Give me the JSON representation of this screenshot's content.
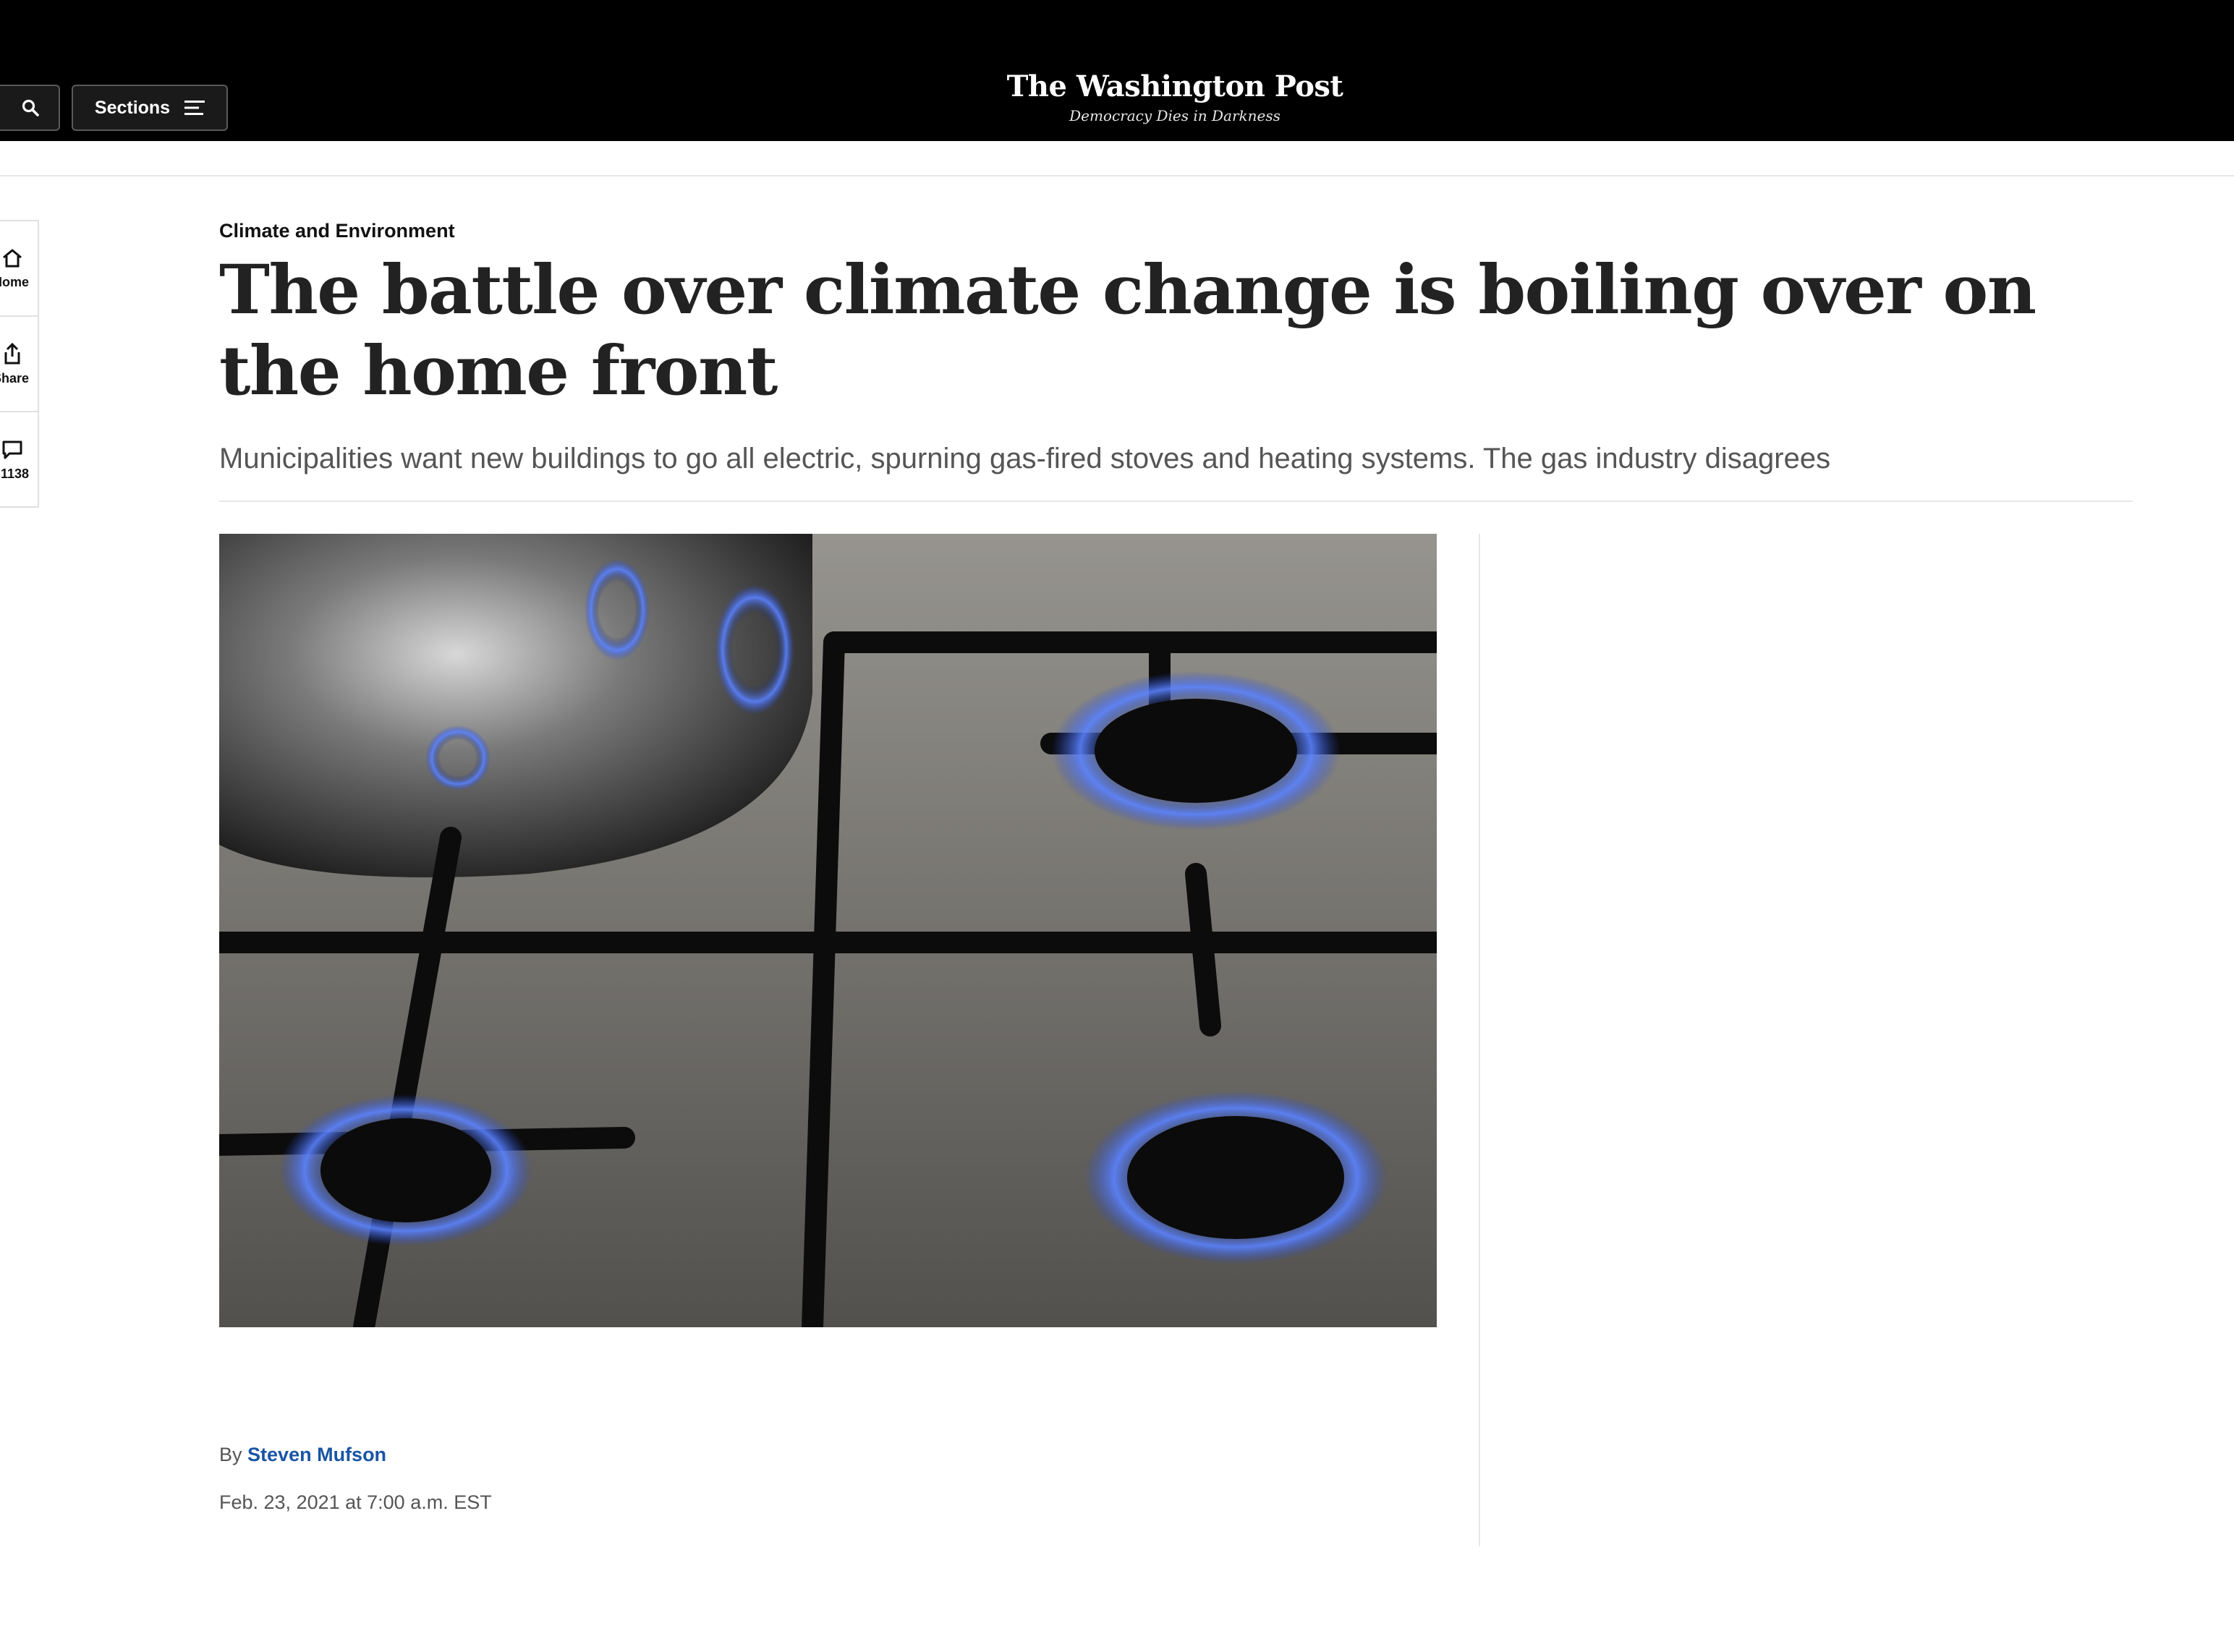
{
  "header": {
    "sections_label": "Sections",
    "masthead_title": "The Washington Post",
    "tagline": "Democracy Dies in Darkness"
  },
  "rail": {
    "home_label": "Home",
    "share_label": "Share",
    "comments_count": "1138"
  },
  "article": {
    "kicker": "Climate and Environment",
    "headline": "The battle over climate change is boiling over on the home front",
    "dek": "Municipalities want new buildings to go all electric, spurning gas-fired stoves and heating systems. The gas industry disagrees",
    "hero_image": "gas-stove-burners-photo",
    "byline_prefix": "By",
    "author": "Steven Mufson",
    "timestamp": "Feb. 23, 2021 at 7:00 a.m. EST"
  },
  "colors": {
    "topbar": "#000000",
    "author_link": "#1955a5",
    "flame": "#4a78ff"
  }
}
